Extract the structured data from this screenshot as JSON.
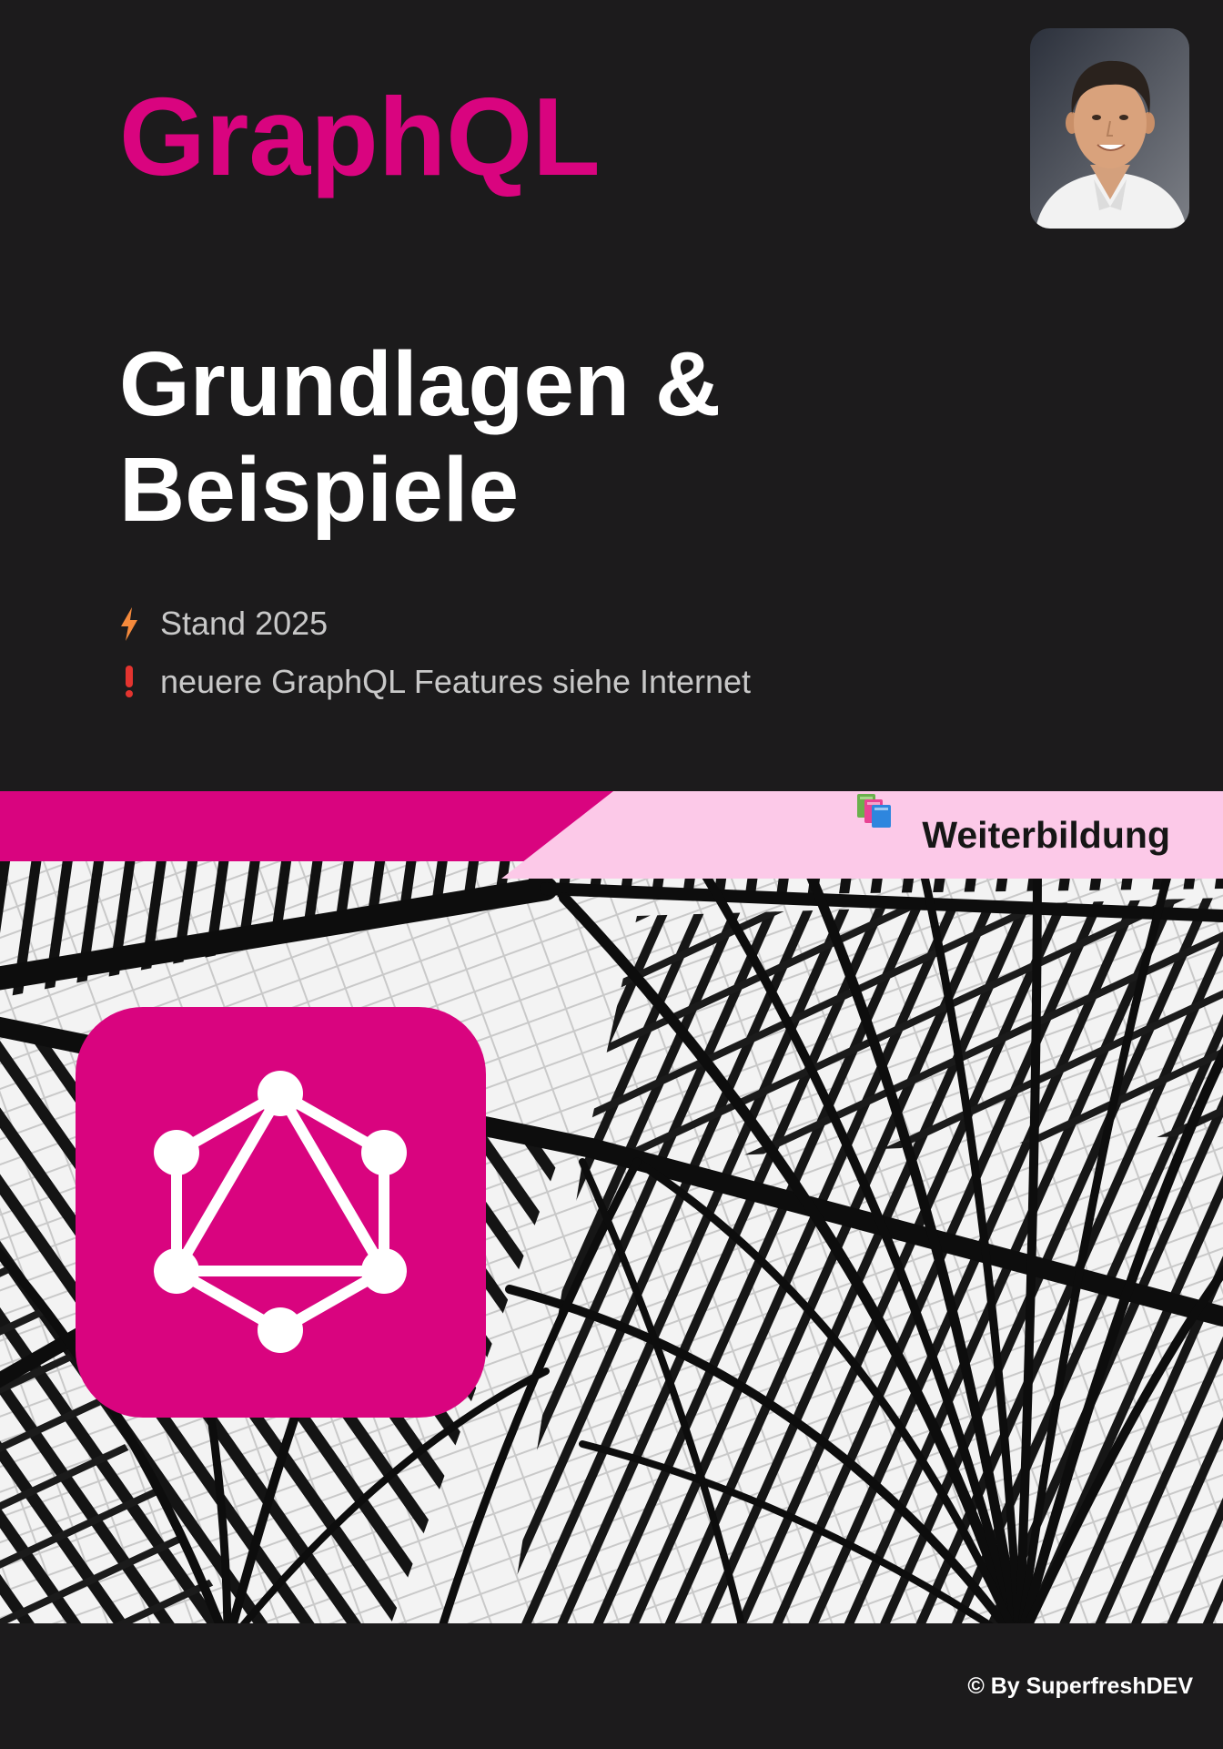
{
  "document": {
    "title": "GraphQL",
    "subtitle": "Grundlagen & Beispiele",
    "notes": [
      {
        "icon": "lightning-icon",
        "text": "Stand 2025"
      },
      {
        "icon": "exclamation-icon",
        "text": "neuere GraphQL Features siehe Internet"
      }
    ],
    "category_badge": {
      "icon": "books-icon",
      "label": "Weiterbildung"
    },
    "logo_icon": "graphql-logo-icon",
    "footer": "© By SuperfreshDEV"
  },
  "colors": {
    "background": "#1c1b1c",
    "accent": "#d9047f",
    "accent_light": "#fcc9e8",
    "muted_text": "#c8c8c8",
    "lightning": "#f58a3c",
    "exclamation": "#e3342f"
  }
}
